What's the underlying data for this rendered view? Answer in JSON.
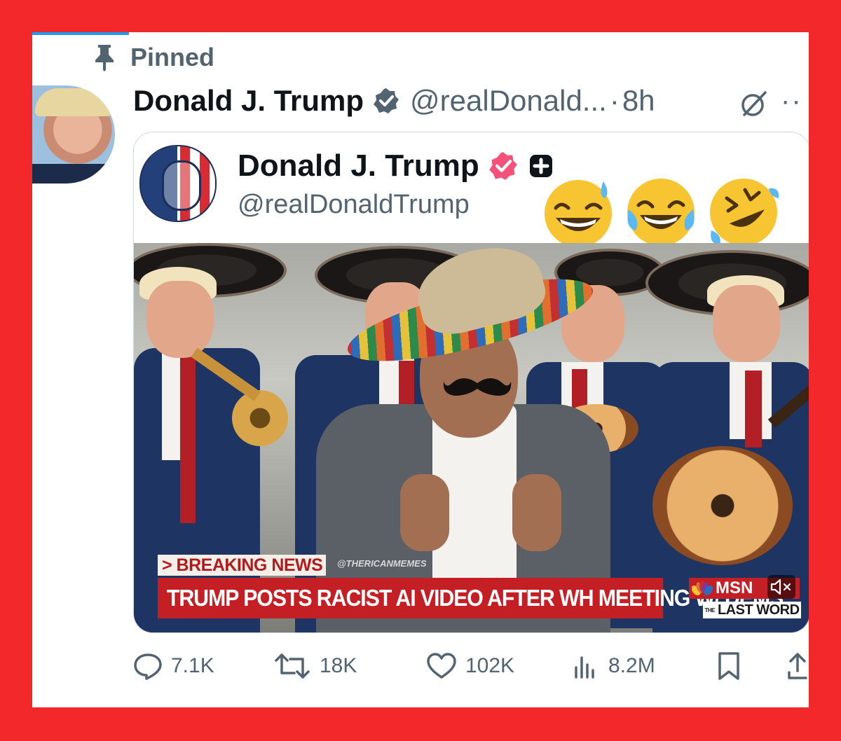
{
  "colors": {
    "frame": "#f3282a",
    "verified_blue": "#1d9bf0",
    "verified_gold": "#f91880",
    "text_primary": "#0f1419",
    "text_secondary": "#536471",
    "breaking_red": "#c41f24"
  },
  "pinned": {
    "icon": "pin-icon",
    "label": "Pinned"
  },
  "tweet": {
    "author_name": "Donald J. Trump",
    "handle": "@realDonald...",
    "separator": "·",
    "time": "8h",
    "verified_icon": "verified-badge-icon"
  },
  "embed": {
    "author_name": "Donald J. Trump",
    "handle": "@realDonaldTrump",
    "emojis": [
      "grinning-sweat-emoji",
      "tears-of-joy-emoji",
      "rolling-laughing-emoji"
    ]
  },
  "video": {
    "breaking_label": "> BREAKING NEWS",
    "watermark": "@THERICANMEMES",
    "headline": "TRUMP POSTS RACIST AI VIDEO AFTER WH MEETING W/ DEMS",
    "network": "MSN",
    "show": "LAST WORD",
    "show_prefix": "THE"
  },
  "actions": {
    "replies": "7.1K",
    "reposts": "18K",
    "likes": "102K",
    "views": "8.2M"
  }
}
